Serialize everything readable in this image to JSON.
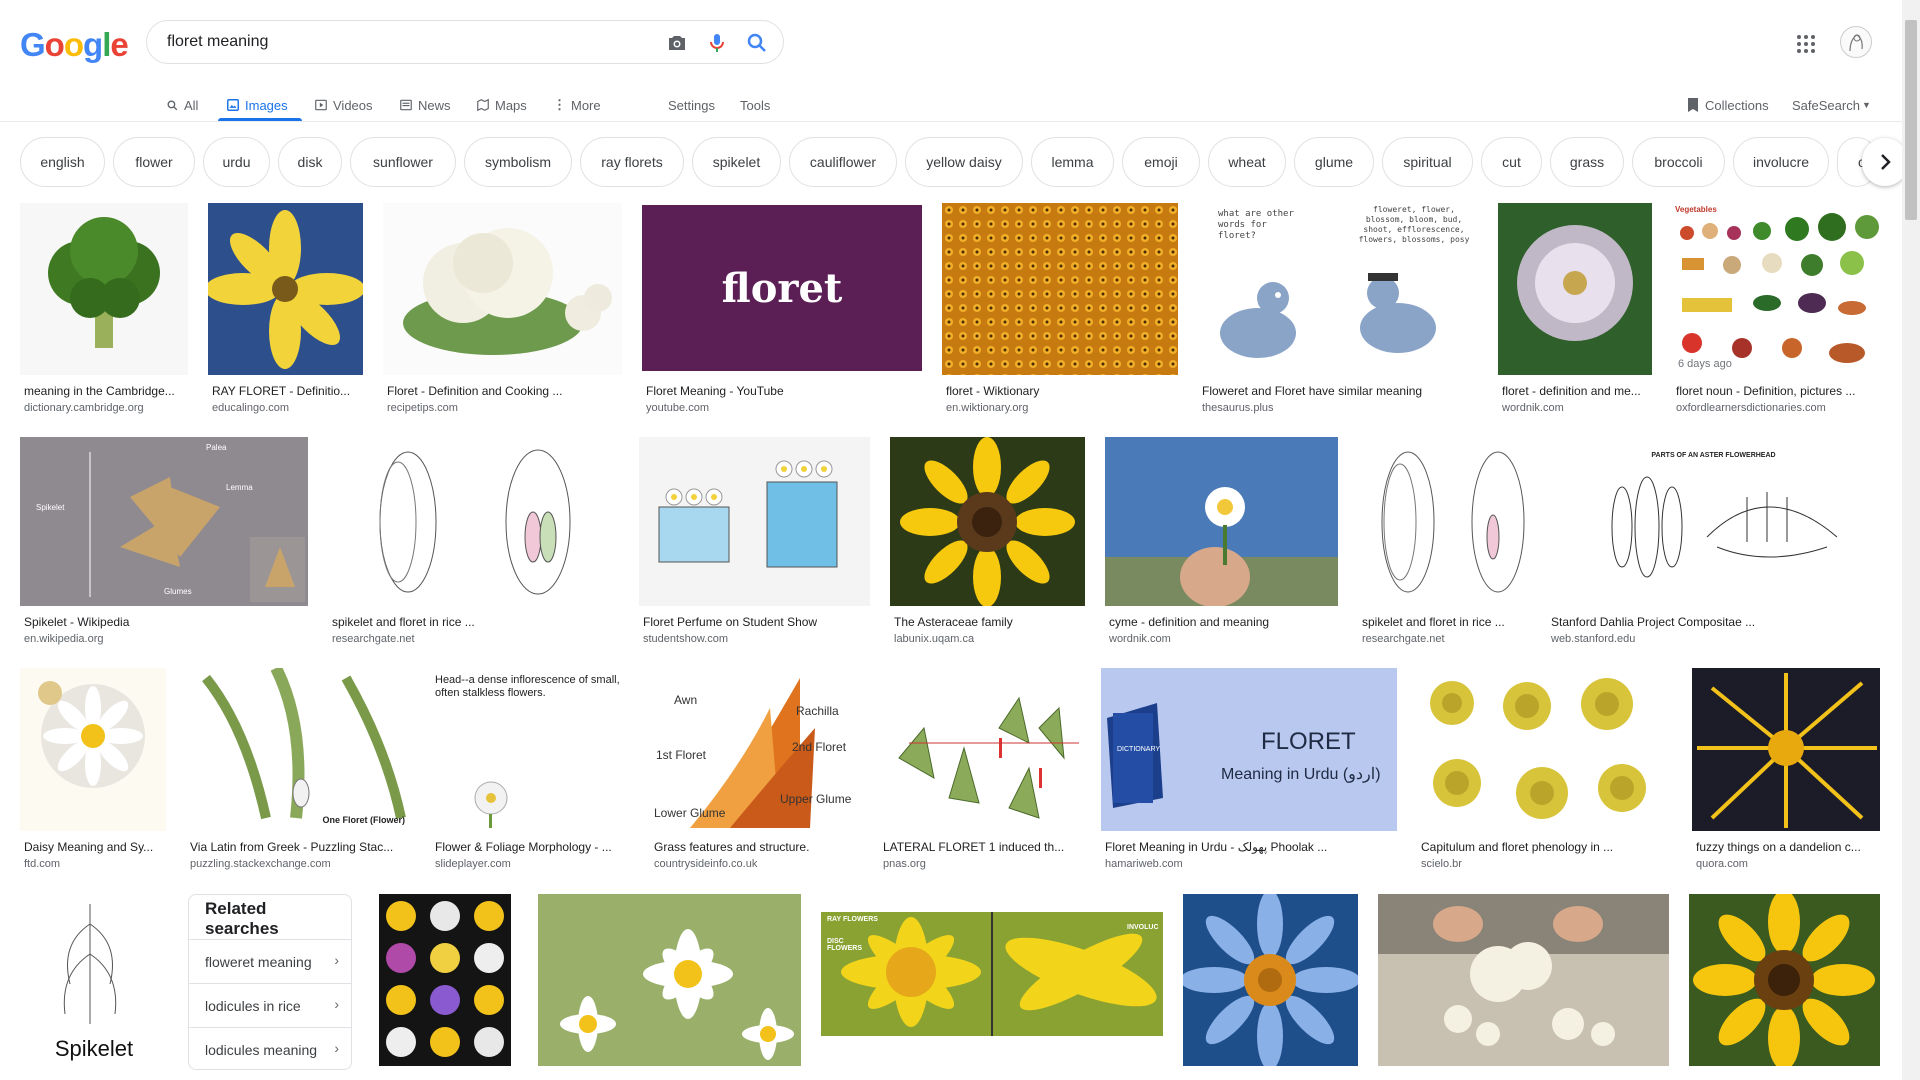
{
  "logo": {
    "letters": [
      "G",
      "o",
      "o",
      "g",
      "l",
      "e"
    ],
    "colors": [
      "#4285f4",
      "#ea4335",
      "#fbbc05",
      "#4285f4",
      "#34a853",
      "#ea4335"
    ]
  },
  "search": {
    "value": "floret meaning",
    "icons": [
      "camera-icon",
      "mic-icon",
      "search-icon"
    ]
  },
  "nav": {
    "all": "All",
    "images": "Images",
    "videos": "Videos",
    "news": "News",
    "maps": "Maps",
    "more": "More",
    "settings": "Settings",
    "tools": "Tools",
    "collections": "Collections",
    "safesearch": "SafeSearch"
  },
  "chips": [
    "english",
    "flower",
    "urdu",
    "disk",
    "sunflower",
    "symbolism",
    "ray florets",
    "spikelet",
    "cauliflower",
    "yellow daisy",
    "lemma",
    "emoji",
    "wheat",
    "glume",
    "spiritual",
    "cut",
    "grass",
    "broccoli",
    "involucre",
    "c"
  ],
  "results": [
    {
      "title": "meaning in the Cambridge...",
      "source": "dictionary.cambridge.org"
    },
    {
      "title": "RAY FLORET - Definitio...",
      "source": "educalingo.com"
    },
    {
      "title": "Floret - Definition and Cooking ...",
      "source": "recipetips.com"
    },
    {
      "title": "Floret Meaning - YouTube",
      "source": "youtube.com",
      "overlay": "floret"
    },
    {
      "title": "floret - Wiktionary",
      "source": "en.wiktionary.org"
    },
    {
      "title": "Floweret and Floret have similar meaning",
      "source": "thesaurus.plus",
      "overlay_lines": [
        "what are other words for floret?",
        "floweret, flower, blossom, bloom, bud, shoot, efflorescence, flowers, blossoms, posy"
      ]
    },
    {
      "title": "floret - definition and me...",
      "source": "wordnik.com"
    },
    {
      "title": "floret noun - Definition, pictures ...",
      "source": "oxfordlearnersdictionaries.com",
      "badge": "6 days ago",
      "overlay": "Vegetables"
    },
    {
      "title": "Spikelet - Wikipedia",
      "source": "en.wikipedia.org",
      "overlay_lines": [
        "Palea",
        "Lemma",
        "Spikelet",
        "Glumes"
      ]
    },
    {
      "title": "spikelet and floret in rice ...",
      "source": "researchgate.net"
    },
    {
      "title": "Floret Perfume on Student Show",
      "source": "studentshow.com"
    },
    {
      "title": "The Asteraceae family",
      "source": "labunix.uqam.ca"
    },
    {
      "title": "cyme - definition and meaning",
      "source": "wordnik.com"
    },
    {
      "title": "spikelet and floret in rice ...",
      "source": "researchgate.net"
    },
    {
      "title": "Stanford Dahlia Project Compositae ...",
      "source": "web.stanford.edu",
      "overlay": "PARTS OF AN ASTER FLOWERHEAD"
    },
    {
      "title": "Daisy Meaning and Sy...",
      "source": "ftd.com"
    },
    {
      "title": "Via Latin from Greek - Puzzling Stac...",
      "source": "puzzling.stackexchange.com",
      "overlay": "One Floret (Flower)"
    },
    {
      "title": "Flower & Foliage Morphology - ...",
      "source": "slideplayer.com",
      "overlay": "Head--a dense inflorescence of small, often stalkless flowers."
    },
    {
      "title": "Grass features and structure.",
      "source": "countrysideinfo.co.uk",
      "overlay_lines": [
        "Awn",
        "Rachilla",
        "1st Floret",
        "2nd Floret",
        "Lower Glume",
        "Upper Glume"
      ]
    },
    {
      "title": "LATERAL FLORET 1 induced th...",
      "source": "pnas.org"
    },
    {
      "title": "Floret Meaning in Urdu - پھولک Phoolak ...",
      "source": "hamariweb.com",
      "overlay_lines": [
        "FLORET",
        "Meaning in Urdu (اردو)",
        "DICTIONARY"
      ]
    },
    {
      "title": "Capitulum and floret phenology in ...",
      "source": "scielo.br"
    },
    {
      "title": "fuzzy things on a dandelion c...",
      "source": "quora.com"
    },
    {
      "title": "",
      "source": "",
      "overlay": "Spikelet"
    },
    {
      "title": "",
      "source": ""
    },
    {
      "title": "",
      "source": ""
    },
    {
      "title": "",
      "source": "",
      "overlay_lines": [
        "RAY FLOWERS",
        "DISC FLOWERS",
        "INVOLUC"
      ]
    },
    {
      "title": "",
      "source": ""
    },
    {
      "title": "",
      "source": ""
    },
    {
      "title": "",
      "source": ""
    }
  ],
  "related": {
    "title_line1": "Related",
    "title_line2": "searches",
    "items": [
      "floweret meaning",
      "lodicules in rice",
      "lodicules meaning"
    ]
  }
}
